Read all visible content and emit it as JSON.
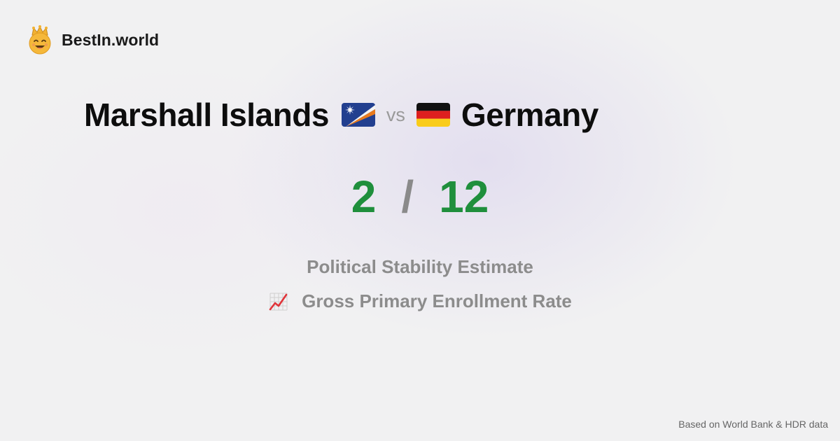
{
  "brand": {
    "name": "BestIn.world",
    "logo_icon": "crown-smiley-icon"
  },
  "comparison": {
    "country_a": "Marshall Islands",
    "flag_a_icon": "marshall-islands-flag-icon",
    "vs_label": "vs",
    "country_b": "Germany",
    "flag_b_icon": "germany-flag-icon"
  },
  "scores": {
    "score_a": "2",
    "separator": "/",
    "score_b": "12",
    "color": "#1f8f3c"
  },
  "metrics": {
    "metric_1": "Political Stability Estimate",
    "metric_2": "Gross Primary Enrollment Rate",
    "metric_2_icon": "chart-increasing-icon"
  },
  "footer": {
    "source": "Based on World Bank & HDR data"
  }
}
